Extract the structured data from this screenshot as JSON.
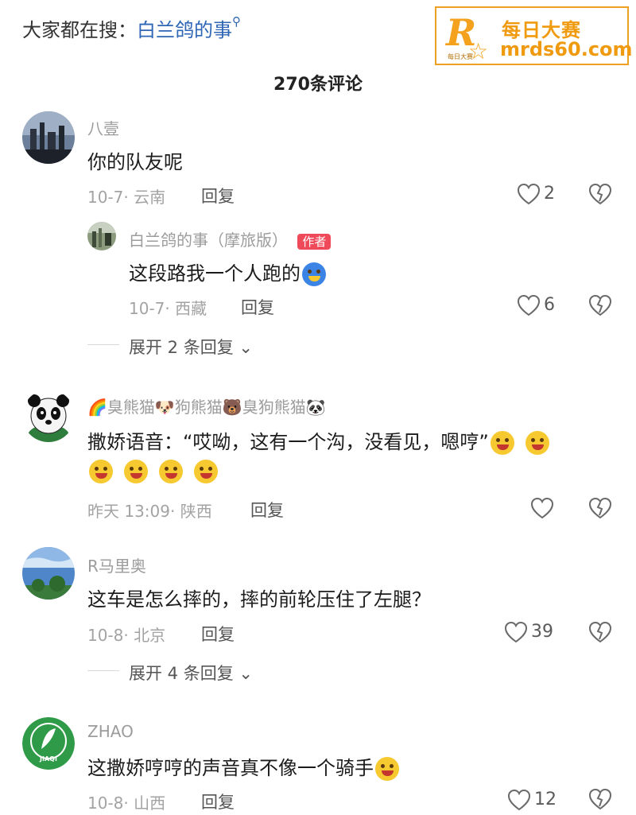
{
  "header": {
    "search_prefix": "大家都在搜：",
    "search_term": "白兰鸽的事",
    "search_icon": "search-icon",
    "watermark_brand": "R",
    "watermark_cn": "每日大赛",
    "watermark_mini": "每日大赛",
    "watermark_url": "mrds60.com",
    "comment_count": "270条评论"
  },
  "comments": [
    {
      "name": "八壹",
      "text": "你的队友呢",
      "meta": "10-7· 云南",
      "reply": "回复",
      "likes": "2"
    },
    {
      "name": "白兰鸽的事（摩旅版）",
      "badge": "作者",
      "text": "这段路我一个人跑的",
      "meta": "10-7· 西藏",
      "reply": "回复",
      "likes": "6"
    },
    {
      "expand": "展开 2 条回复"
    },
    {
      "name_parts": [
        "臭熊猫",
        "狗熊猫",
        "臭狗熊猫"
      ],
      "text": "撒娇语音：“哎呦，这有一个沟，没看见，嗯哼”",
      "meta": "昨天 13:09· 陕西",
      "reply": "回复",
      "likes": ""
    },
    {
      "name": "R马里奥",
      "text": "这车是怎么摔的，摔的前轮压住了左腿？",
      "meta": "10-8· 北京",
      "reply": "回复",
      "likes": "39"
    },
    {
      "expand": "展开 4 条回复"
    },
    {
      "name": "ZHAO",
      "avatar_text": "JIAQI",
      "text": "这撒娇哼哼的声音真不像一个骑手",
      "meta": "10-8· 山西",
      "reply": "回复",
      "likes": "12"
    }
  ],
  "colors": {
    "highlight": "#2f66b5",
    "badge": "#ef4a5a",
    "watermark": "#f09a10"
  }
}
